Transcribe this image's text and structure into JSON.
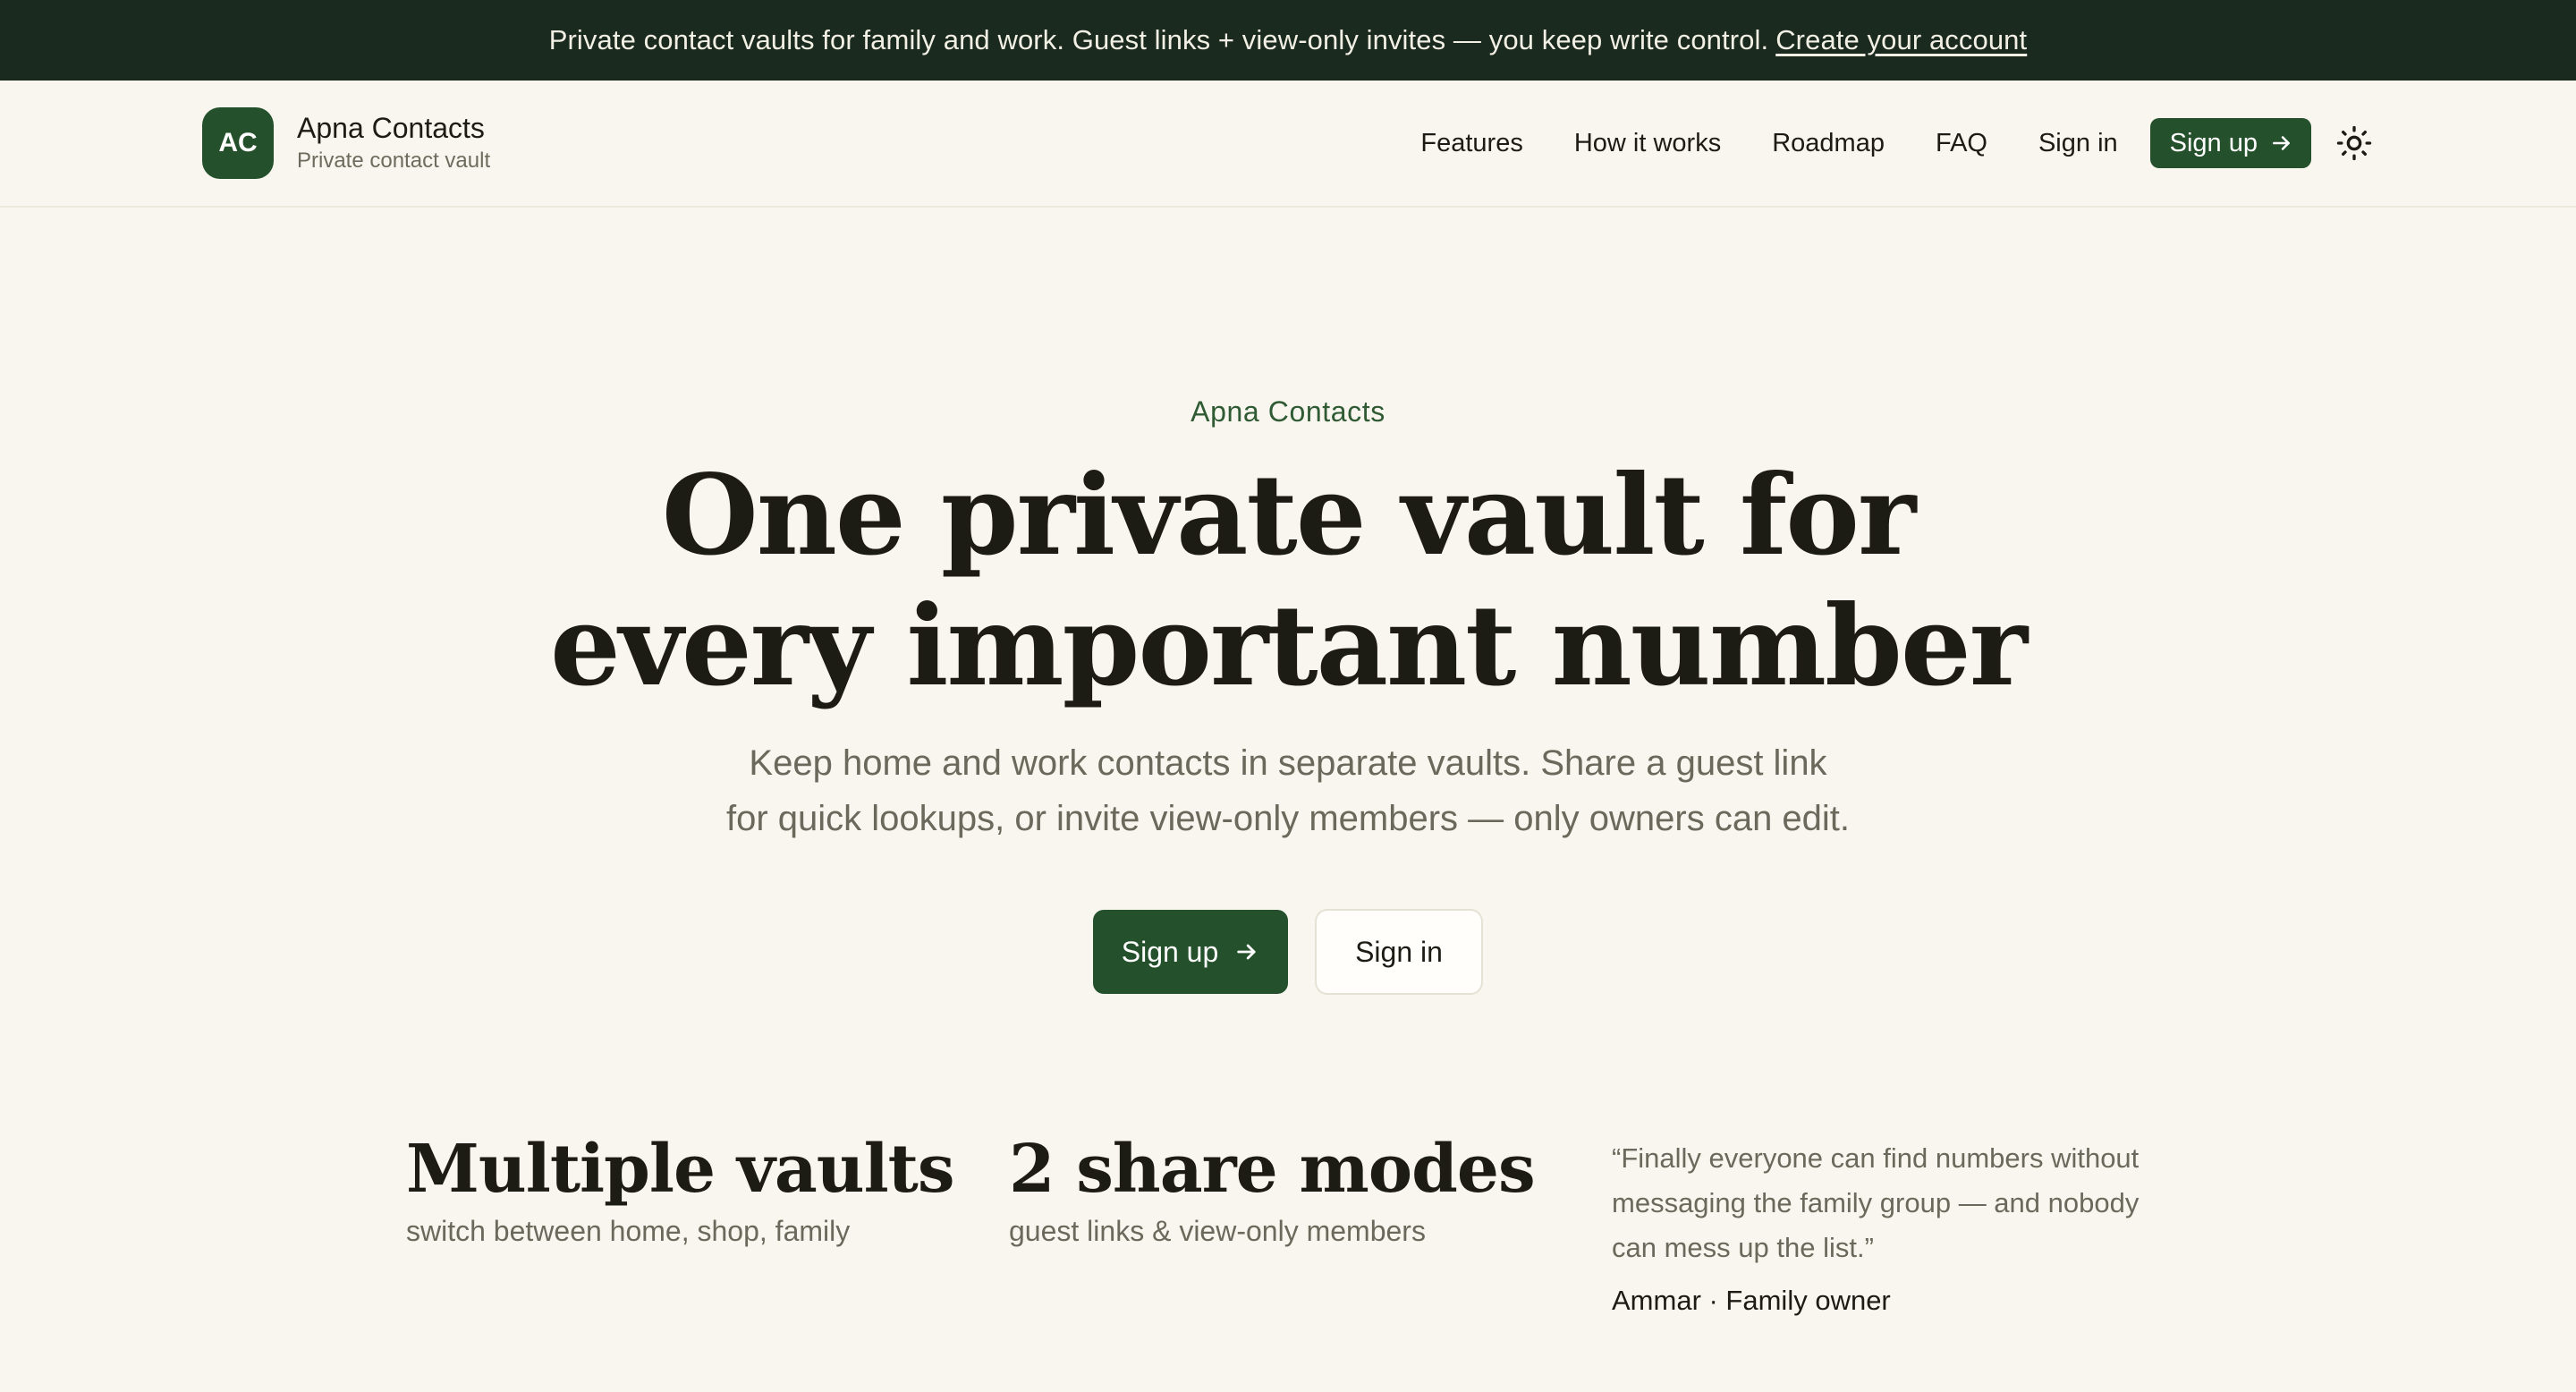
{
  "announcement": {
    "text": "Private contact vaults for family and work. Guest links + view-only invites — you keep write control.",
    "link_label": "Create your account"
  },
  "header": {
    "logo_initials": "AC",
    "brand_name": "Apna Contacts",
    "brand_tagline": "Private contact vault",
    "nav": [
      {
        "label": "Features"
      },
      {
        "label": "How it works"
      },
      {
        "label": "Roadmap"
      },
      {
        "label": "FAQ"
      },
      {
        "label": "Sign in"
      }
    ],
    "signup_label": "Sign up",
    "theme_icon": "sun-icon"
  },
  "hero": {
    "eyebrow": "Apna Contacts",
    "headline_line1": "One private vault for",
    "headline_line2": "every important number",
    "subhead_line1": "Keep home and work contacts in separate vaults. Share a guest link",
    "subhead_line2": "for quick lookups, or invite view-only members — only owners can edit.",
    "primary_cta": "Sign up",
    "secondary_cta": "Sign in"
  },
  "stats": [
    {
      "title": "Multiple vaults",
      "subtitle": "switch between home, shop, family"
    },
    {
      "title": "2 share modes",
      "subtitle": "guest links & view-only members"
    }
  ],
  "testimonial": {
    "line1": "“Finally everyone can find numbers without",
    "line2": "messaging the family group — and nobody",
    "line3": "can mess up the list.”",
    "author": "Ammar · Family owner"
  },
  "colors": {
    "background": "#f8f6ee",
    "announcement_bg": "#1b2a1e",
    "accent": "#24512b",
    "text": "#1d1c14",
    "muted": "#6b685c"
  }
}
